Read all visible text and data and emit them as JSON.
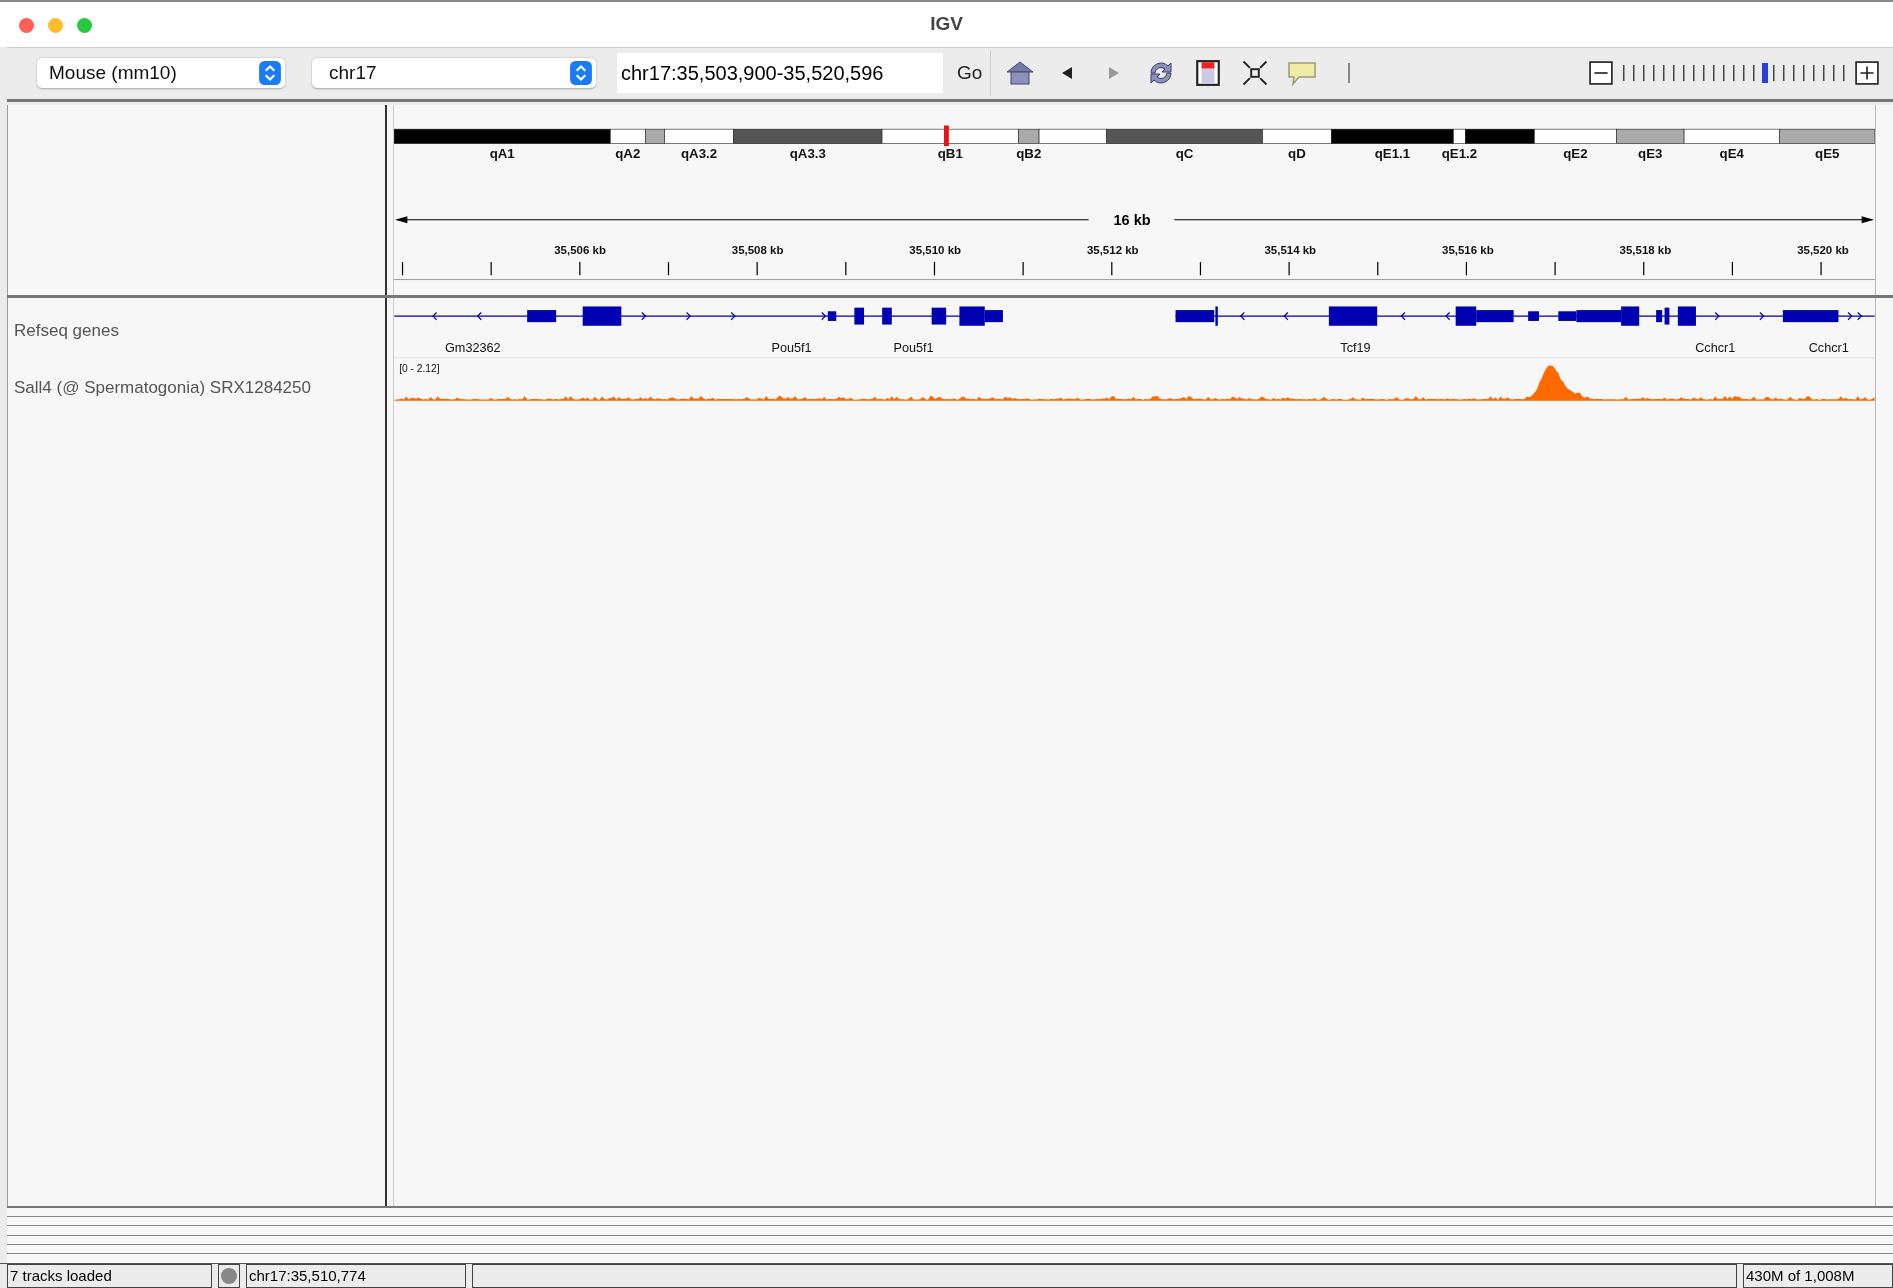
{
  "window": {
    "title": "IGV"
  },
  "toolbar": {
    "genome": "Mouse (mm10)",
    "chromosome": "chr17",
    "locus": "chr17:35,503,900-35,520,596",
    "go": "Go",
    "back": {
      "disabled": false
    },
    "forward": {
      "disabled": true
    },
    "zoom": {
      "level": 0.64
    }
  },
  "ideogram": {
    "level": 0.373,
    "bands": [
      {
        "label": "qA1",
        "color": "#000000"
      },
      {
        "label": "qA2",
        "color": "#ffffff"
      },
      {
        "color": "#aaaaaa"
      },
      {
        "label": "qA3.2",
        "color": "#ffffff"
      },
      {
        "label": "qA3.3",
        "color": "#555555"
      },
      {
        "label": "qB1",
        "color": "#ffffff"
      },
      {
        "label": "qB2",
        "color": "#aaaaaa"
      },
      {
        "color": "#ffffff"
      },
      {
        "label": "qC",
        "color": "#555555"
      },
      {
        "label": "qD",
        "color": "#ffffff"
      },
      {
        "label": "qE1.1",
        "color": "#000000"
      },
      {
        "label": "qE1.2",
        "color": "#ffffff"
      },
      {
        "color": "#000000"
      },
      {
        "label": "qE2",
        "color": "#ffffff"
      },
      {
        "label": "qE3",
        "color": "#aaaaaa"
      },
      {
        "label": "qE4",
        "color": "#ffffff"
      },
      {
        "label": "qE5",
        "color": "#aaaaaa"
      }
    ]
  },
  "ruler": {
    "span": "16 kb",
    "ticks": [
      "35,506 kb",
      "35,508 kb",
      "35,510 kb",
      "35,512 kb",
      "35,514 kb",
      "35,516 kb",
      "35,518 kb",
      "35,520 kb"
    ]
  },
  "tracks": [
    {
      "kind": "genes",
      "name": "Refseq genes",
      "genes": [
        "Gm32362",
        "Pou5f1",
        "Pou5f1",
        "Tcf19",
        "Cchcr1",
        "Cchcr1"
      ]
    },
    {
      "kind": "signal",
      "name": "Sall4 (@ Spermatogonia) SRX1284250",
      "range": "[0 - 2.12]"
    }
  ],
  "status_bar": {
    "message": "7 tracks loaded",
    "position": "chr17:35,510,774",
    "memory": "430M of 1,008M"
  }
}
